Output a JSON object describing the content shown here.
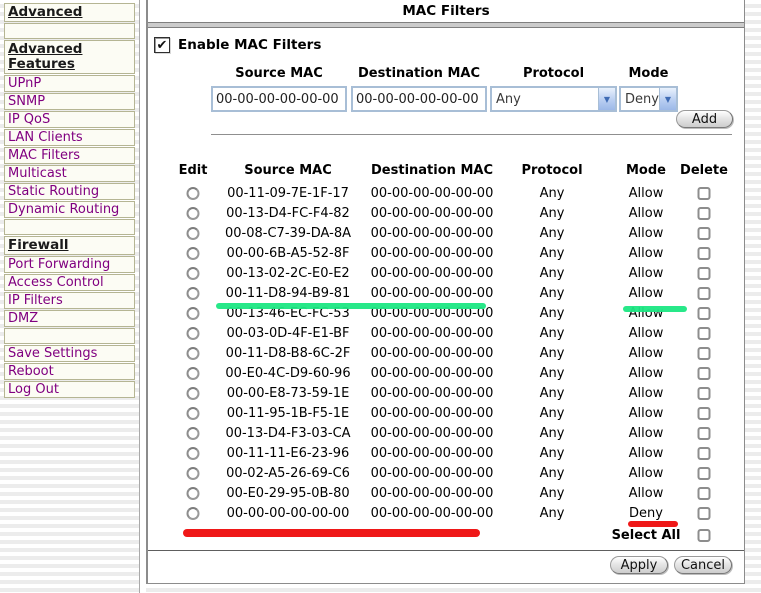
{
  "window": {
    "title": "MAC Filters"
  },
  "icons": {
    "chevron_down": "▼",
    "check": "✔"
  },
  "sidebar": {
    "items": [
      {
        "type": "header",
        "label": "Advanced"
      },
      {
        "type": "spacer",
        "label": ""
      },
      {
        "type": "header",
        "label": "Advanced Features"
      },
      {
        "type": "link",
        "label": "UPnP"
      },
      {
        "type": "link",
        "label": "SNMP"
      },
      {
        "type": "link",
        "label": "IP QoS"
      },
      {
        "type": "link",
        "label": "LAN Clients"
      },
      {
        "type": "link",
        "label": "MAC Filters"
      },
      {
        "type": "link",
        "label": "Multicast"
      },
      {
        "type": "link",
        "label": "Static Routing"
      },
      {
        "type": "link",
        "label": "Dynamic Routing"
      },
      {
        "type": "spacer",
        "label": ""
      },
      {
        "type": "header",
        "label": "Firewall"
      },
      {
        "type": "link",
        "label": "Port Forwarding"
      },
      {
        "type": "link",
        "label": "Access Control"
      },
      {
        "type": "link",
        "label": "IP Filters"
      },
      {
        "type": "link",
        "label": "DMZ"
      },
      {
        "type": "spacer",
        "label": ""
      },
      {
        "type": "link",
        "label": "Save Settings"
      },
      {
        "type": "link",
        "label": "Reboot"
      },
      {
        "type": "link",
        "label": "Log Out"
      }
    ]
  },
  "form": {
    "enable_label": "Enable MAC Filters",
    "enabled": true,
    "source_header": "Source MAC",
    "dest_header": "Destination MAC",
    "protocol_header": "Protocol",
    "mode_header": "Mode",
    "source_value": "00-00-00-00-00-00",
    "dest_value": "00-00-00-00-00-00",
    "protocol_value": "Any",
    "mode_value": "Deny",
    "add_label": "Add"
  },
  "table": {
    "headers": {
      "edit": "Edit",
      "source": "Source MAC",
      "dest": "Destination MAC",
      "protocol": "Protocol",
      "mode": "Mode",
      "delete": "Delete"
    },
    "rows": [
      {
        "source": "00-11-09-7E-1F-17",
        "dest": "00-00-00-00-00-00",
        "protocol": "Any",
        "mode": "Allow"
      },
      {
        "source": "00-13-D4-FC-F4-82",
        "dest": "00-00-00-00-00-00",
        "protocol": "Any",
        "mode": "Allow"
      },
      {
        "source": "00-08-C7-39-DA-8A",
        "dest": "00-00-00-00-00-00",
        "protocol": "Any",
        "mode": "Allow"
      },
      {
        "source": "00-00-6B-A5-52-8F",
        "dest": "00-00-00-00-00-00",
        "protocol": "Any",
        "mode": "Allow"
      },
      {
        "source": "00-13-02-2C-E0-E2",
        "dest": "00-00-00-00-00-00",
        "protocol": "Any",
        "mode": "Allow"
      },
      {
        "source": "00-11-D8-94-B9-81",
        "dest": "00-00-00-00-00-00",
        "protocol": "Any",
        "mode": "Allow"
      },
      {
        "source": "00-13-46-EC-FC-53",
        "dest": "00-00-00-00-00-00",
        "protocol": "Any",
        "mode": "Allow"
      },
      {
        "source": "00-03-0D-4F-E1-BF",
        "dest": "00-00-00-00-00-00",
        "protocol": "Any",
        "mode": "Allow"
      },
      {
        "source": "00-11-D8-B8-6C-2F",
        "dest": "00-00-00-00-00-00",
        "protocol": "Any",
        "mode": "Allow"
      },
      {
        "source": "00-E0-4C-D9-60-96",
        "dest": "00-00-00-00-00-00",
        "protocol": "Any",
        "mode": "Allow"
      },
      {
        "source": "00-00-E8-73-59-1E",
        "dest": "00-00-00-00-00-00",
        "protocol": "Any",
        "mode": "Allow"
      },
      {
        "source": "00-11-95-1B-F5-1E",
        "dest": "00-00-00-00-00-00",
        "protocol": "Any",
        "mode": "Allow"
      },
      {
        "source": "00-13-D4-F3-03-CA",
        "dest": "00-00-00-00-00-00",
        "protocol": "Any",
        "mode": "Allow"
      },
      {
        "source": "00-11-11-E6-23-96",
        "dest": "00-00-00-00-00-00",
        "protocol": "Any",
        "mode": "Allow"
      },
      {
        "source": "00-02-A5-26-69-C6",
        "dest": "00-00-00-00-00-00",
        "protocol": "Any",
        "mode": "Allow"
      },
      {
        "source": "00-E0-29-95-0B-80",
        "dest": "00-00-00-00-00-00",
        "protocol": "Any",
        "mode": "Allow"
      },
      {
        "source": "00-00-00-00-00-00",
        "dest": "00-00-00-00-00-00",
        "protocol": "Any",
        "mode": "Deny"
      }
    ],
    "select_all_label": "Select All"
  },
  "footer": {
    "apply_label": "Apply",
    "cancel_label": "Cancel"
  },
  "annotations": {
    "green": "#1ce783",
    "red": "#ee0c0c"
  }
}
